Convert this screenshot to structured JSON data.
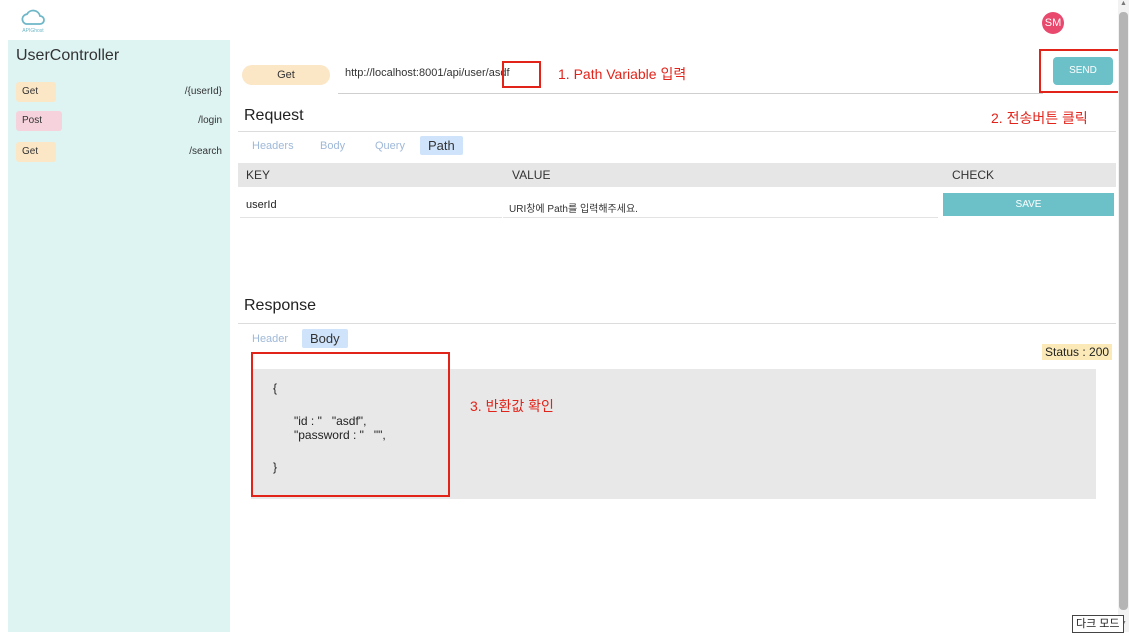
{
  "header": {
    "logo_label": "APIGhost",
    "avatar_initials": "SM"
  },
  "sidebar": {
    "title": "UserController",
    "items": [
      {
        "method": "Get",
        "path": "/{userId}"
      },
      {
        "method": "Post",
        "path": "/login"
      },
      {
        "method": "Get",
        "path": "/search"
      }
    ]
  },
  "request_bar": {
    "method": "Get",
    "url": "http://localhost:8001/api/user/asdf",
    "send_label": "SEND"
  },
  "annotations": {
    "note1": "1. Path Variable 입력",
    "note2": "2. 전송버튼 클릭",
    "note3": "3. 반환값 확인"
  },
  "request": {
    "title": "Request",
    "tabs": [
      "Headers",
      "Body",
      "Query",
      "Path"
    ],
    "active_tab": "Path",
    "table": {
      "columns": [
        "KEY",
        "VALUE",
        "CHECK"
      ],
      "rows": [
        {
          "key": "userId",
          "value": "URI창에 Path를 입력해주세요.",
          "action": "SAVE"
        }
      ]
    }
  },
  "response": {
    "title": "Response",
    "tabs": [
      "Header",
      "Body"
    ],
    "active_tab": "Body",
    "status": "Status : 200",
    "body_lines": [
      "{",
      "\"id : \"   \"asdf\",",
      "\"password : \"   \"\",",
      "}"
    ]
  },
  "footer": {
    "dark_mode_label": "다크 모드"
  },
  "colors": {
    "sidebar_bg": "#def4f3",
    "accent": "#6cc1c9",
    "get_badge": "#fbe6c6",
    "post_badge": "#f6d2dc",
    "annotation_red": "#e2231a",
    "avatar": "#e8496d"
  }
}
